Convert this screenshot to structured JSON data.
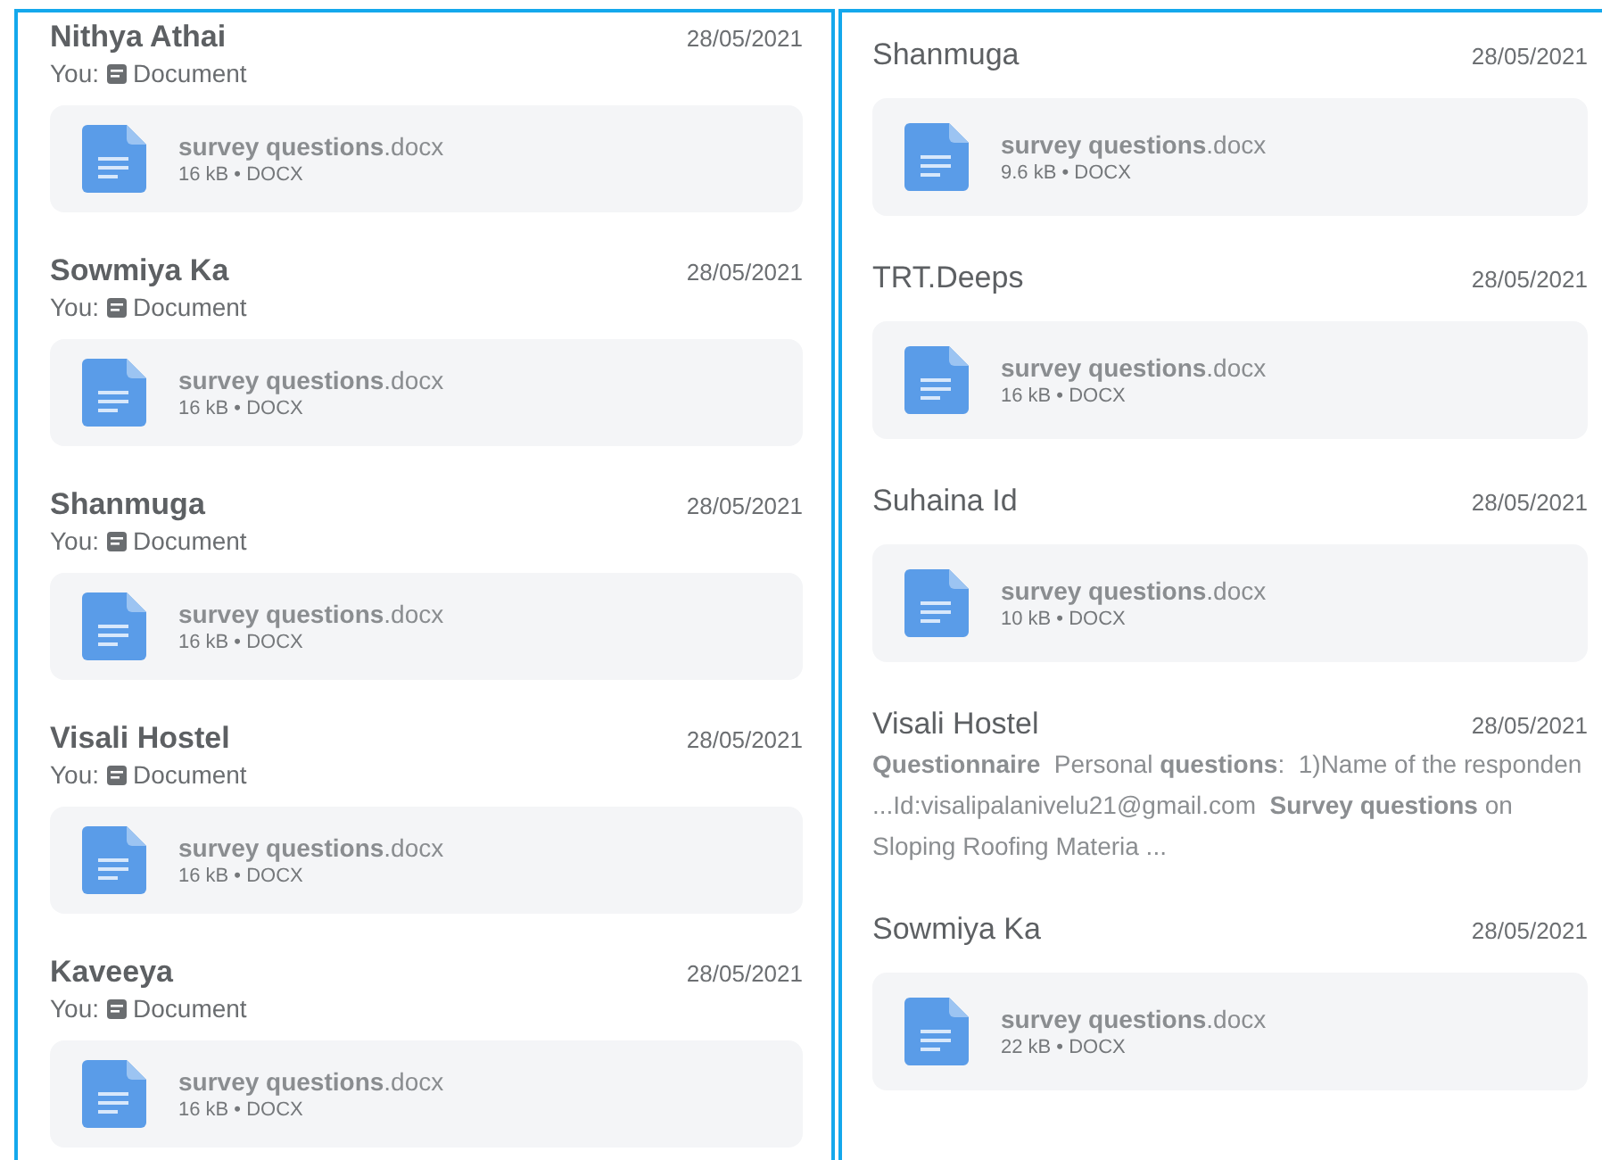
{
  "panels": [
    {
      "items": [
        {
          "name": "Nithya Athai",
          "date": "28/05/2021",
          "preview": {
            "sender": "You:",
            "label": "Document"
          },
          "attachment": {
            "title": "**survey questions**.docx",
            "meta": "16 kB • DOCX"
          }
        },
        {
          "name": "Sowmiya Ka",
          "date": "28/05/2021",
          "preview": {
            "sender": "You:",
            "label": "Document"
          },
          "attachment": {
            "title": "**survey questions**.docx",
            "meta": "16 kB • DOCX"
          }
        },
        {
          "name": "Shanmuga",
          "date": "28/05/2021",
          "preview": {
            "sender": "You:",
            "label": "Document"
          },
          "attachment": {
            "title": "**survey questions**.docx",
            "meta": "16 kB • DOCX"
          }
        },
        {
          "name": "Visali Hostel",
          "date": "28/05/2021",
          "preview": {
            "sender": "You:",
            "label": "Document"
          },
          "attachment": {
            "title": "**survey questions**.docx",
            "meta": "16 kB • DOCX"
          }
        },
        {
          "name": "Kaveeya",
          "date": "28/05/2021",
          "preview": {
            "sender": "You:",
            "label": "Document"
          },
          "attachment": {
            "title": "**survey questions**.docx",
            "meta": "16 kB • DOCX"
          }
        }
      ]
    },
    {
      "items": [
        {
          "name": "Shanmuga",
          "date": "28/05/2021",
          "attachment": {
            "title": "**survey questions**.docx",
            "meta": "9.6 kB • DOCX"
          }
        },
        {
          "name": "TRT.Deeps",
          "date": "28/05/2021",
          "attachment": {
            "title": "**survey questions**.docx",
            "meta": "16 kB • DOCX"
          }
        },
        {
          "name": "Suhaina Id",
          "date": "28/05/2021",
          "attachment": {
            "title": "**survey questions**.docx",
            "meta": "10 kB • DOCX"
          }
        },
        {
          "name": "Visali Hostel",
          "date": "28/05/2021",
          "snippet": "**Questionnaire**  Personal **questions**:  1)Name of the responden ...Id:visalipalanivelu21@gmail.com  **Survey questions** on Sloping Roofing Materia ..."
        },
        {
          "name": "Sowmiya Ka",
          "date": "28/05/2021",
          "attachment": {
            "title": "**survey questions**.docx",
            "meta": "22 kB • DOCX"
          }
        }
      ]
    }
  ]
}
